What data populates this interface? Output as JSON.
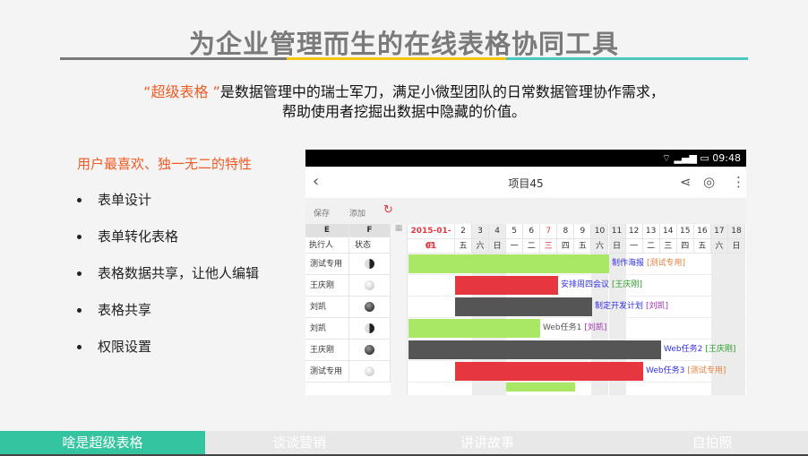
{
  "title": "为企业管理而生的在线表格协同工具",
  "title_line_colors": [
    "#7a7a7a",
    "#f5c400",
    "#4cc8c0"
  ],
  "intro": {
    "highlight": "“超级表格 ”",
    "line1": "是数据管理中的瑞士军刀，满足小微型团队的日常数据管理协作需求，",
    "line2": "帮助使用者挖掘出数据中隐藏的价值。"
  },
  "features": {
    "heading": "用户最喜欢、独一无二的特性",
    "items": [
      "表单设计",
      "表单转化表格",
      "表格数据共享，让他人编辑",
      "表格共享",
      "权限设置"
    ]
  },
  "phone": {
    "status_time": "09:48",
    "title": "项目45",
    "toolbar": {
      "save": "保存",
      "add": "添加"
    },
    "col_letters": [
      "E",
      "F"
    ],
    "col_headers": [
      "执行人",
      "状态"
    ],
    "date_first": "2015-01-01",
    "days": [
      "2",
      "3",
      "4",
      "5",
      "6",
      "7",
      "8",
      "9",
      "10",
      "11",
      "12",
      "13",
      "14",
      "15",
      "16",
      "17",
      "18"
    ],
    "weekdays": [
      "四",
      "五",
      "六",
      "日",
      "一",
      "二",
      "三",
      "四",
      "五",
      "六",
      "日",
      "一",
      "二",
      "三",
      "四",
      "五",
      "六",
      "日"
    ],
    "rows": [
      {
        "person": "测试专用",
        "status": "half",
        "task": "制作海报",
        "owner": "[测试专用]",
        "color": "#a8e864"
      },
      {
        "person": "王庆刚",
        "status": "empty",
        "task": "安排周四会议",
        "owner": "[王庆刚]",
        "color": "#e63740"
      },
      {
        "person": "刘凯",
        "status": "full",
        "task": "制定开发计划",
        "owner": "[刘凯]",
        "color": "#555555"
      },
      {
        "person": "刘凯",
        "status": "half",
        "task": "Web任务1",
        "owner": "[刘凯]",
        "color": "#a8e864"
      },
      {
        "person": "王庆刚",
        "status": "full",
        "task": "Web任务2",
        "owner": "[王庆刚]",
        "color": "#555555"
      },
      {
        "person": "测试专用",
        "status": "empty",
        "task": "Web任务3",
        "owner": "[测试专用]",
        "color": "#e63740"
      }
    ]
  },
  "tabs": [
    "啥是超级表格",
    "谈谈营销",
    "讲讲故事",
    "自拍照"
  ],
  "accent": "#34c5a0"
}
